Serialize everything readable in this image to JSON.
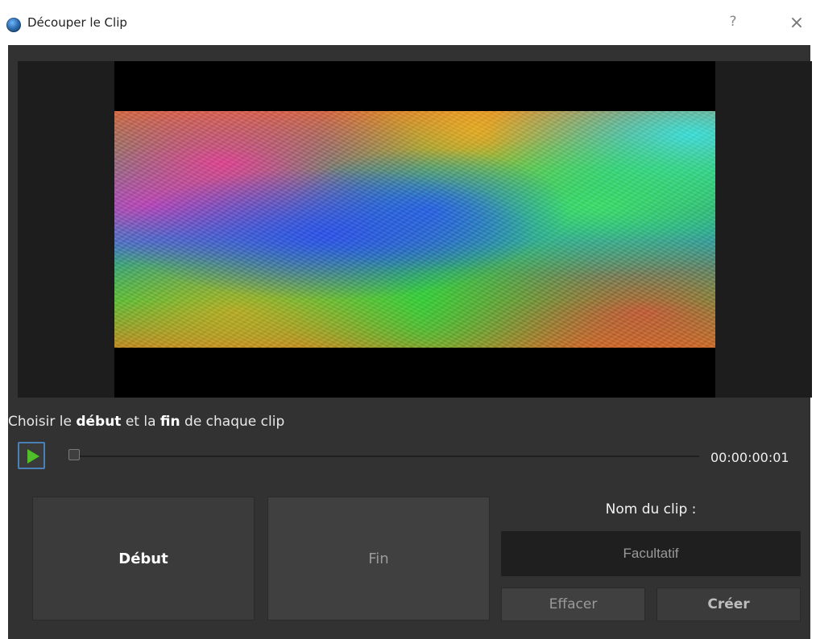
{
  "window": {
    "title": "Découper le Clip",
    "help": "?",
    "close": "×"
  },
  "instruction": {
    "prefix": "Choisir le ",
    "start_word": "début",
    "middle": " et la ",
    "end_word": "fin",
    "suffix": " de chaque clip"
  },
  "playback": {
    "timecode": "00:00:00:01"
  },
  "actions": {
    "debut_label": "Début",
    "fin_label": "Fin"
  },
  "clip": {
    "name_label": "Nom du clip :",
    "placeholder": "Facultatif",
    "clear_label": "Effacer",
    "create_label": "Créer"
  },
  "icons": {
    "app": "app-icon",
    "play": "play-icon"
  }
}
